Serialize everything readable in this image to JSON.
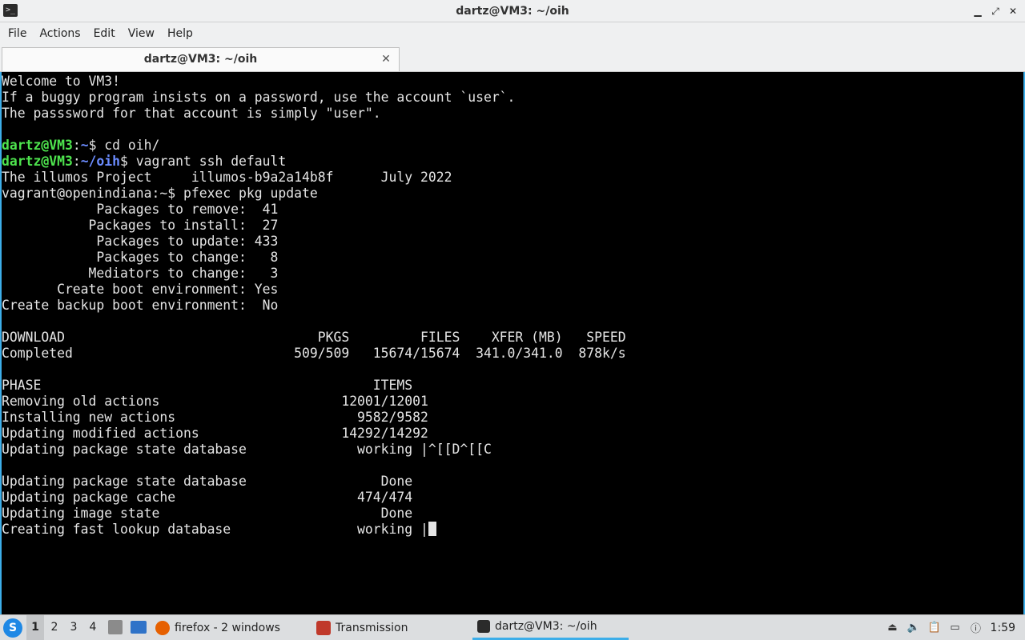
{
  "window": {
    "title": "dartz@VM3: ~/oih",
    "minimize": "▁",
    "maximize": "⤢",
    "close": "✕"
  },
  "menu": [
    "File",
    "Actions",
    "Edit",
    "View",
    "Help"
  ],
  "tab": {
    "label": "dartz@VM3: ~/oih",
    "close": "✕"
  },
  "terminal": {
    "lines": [
      {
        "text": "Welcome to VM3!"
      },
      {
        "text": "If a buggy program insists on a password, use the account `user`."
      },
      {
        "text": "The passsword for that account is simply \"user\"."
      },
      {
        "text": ""
      },
      {
        "prompt": {
          "user": "dartz@VM3",
          "path": "~",
          "symbol": "$"
        },
        "text": " cd oih/"
      },
      {
        "prompt": {
          "user": "dartz@VM3",
          "path": "~/oih",
          "symbol": "$"
        },
        "text": " vagrant ssh default"
      },
      {
        "text": "The illumos Project     illumos-b9a2a14b8f      July 2022"
      },
      {
        "text": "vagrant@openindiana:~$ pfexec pkg update"
      },
      {
        "text": "            Packages to remove:  41"
      },
      {
        "text": "           Packages to install:  27"
      },
      {
        "text": "            Packages to update: 433"
      },
      {
        "text": "            Packages to change:   8"
      },
      {
        "text": "           Mediators to change:   3"
      },
      {
        "text": "       Create boot environment: Yes"
      },
      {
        "text": "Create backup boot environment:  No"
      },
      {
        "text": ""
      },
      {
        "text": "DOWNLOAD                                PKGS         FILES    XFER (MB)   SPEED"
      },
      {
        "text": "Completed                            509/509   15674/15674  341.0/341.0  878k/s"
      },
      {
        "text": ""
      },
      {
        "text": "PHASE                                          ITEMS"
      },
      {
        "text": "Removing old actions                       12001/12001"
      },
      {
        "text": "Installing new actions                       9582/9582"
      },
      {
        "text": "Updating modified actions                  14292/14292"
      },
      {
        "text": "Updating package state database              working |^[[D^[[C"
      },
      {
        "text": ""
      },
      {
        "text": "Updating package state database                 Done"
      },
      {
        "text": "Updating package cache                       474/474"
      },
      {
        "text": "Updating image state                            Done"
      },
      {
        "text": "Creating fast lookup database                working |",
        "cursor": true
      }
    ]
  },
  "taskbar": {
    "workspaces": [
      "1",
      "2",
      "3",
      "4"
    ],
    "active_workspace": "1",
    "tasks": [
      {
        "name": "firefox",
        "label": "firefox - 2 windows",
        "icon": "firefox-icon",
        "color": "#e66000"
      },
      {
        "name": "transmission",
        "label": "Transmission",
        "icon": "transmission-icon",
        "color": "#c0392b"
      },
      {
        "name": "terminal",
        "label": "dartz@VM3: ~/oih",
        "icon": "terminal-icon",
        "color": "#2b2b2b"
      }
    ],
    "clock": "1:59"
  },
  "colors": {
    "accent": "#3daee9",
    "prompt_user": "#4ee44e",
    "prompt_path": "#6b8cff",
    "terminal_bg": "#000000",
    "terminal_fg": "#e5e5e5"
  }
}
